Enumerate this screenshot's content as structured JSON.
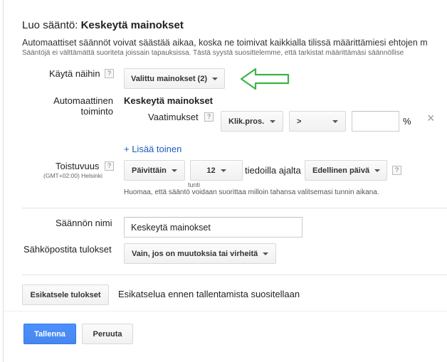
{
  "dialog": {
    "title_prefix": "Luo sääntö:",
    "title_rule": "Keskeytä mainokset",
    "description": "Automaattiset säännöt voivat säästää aikaa, koska ne toimivat kaikkialla tilissä määrittämiesi ehtojen m",
    "description_small": "Sääntöjä ei välttämättä suoriteta joissain tapauksissa. Tästä syystä suosittelemme, että tarkistat määrittämäsi säännöllise"
  },
  "apply_to": {
    "label": "Käytä näihin",
    "help": "?",
    "button": "Valittu mainokset (2)"
  },
  "action": {
    "label_line1": "Automaattinen",
    "label_line2": "toiminto",
    "value": "Keskeytä mainokset"
  },
  "requirements": {
    "label": "Vaatimukset",
    "help": "?",
    "metric": "Klik.pros.",
    "operator": ">",
    "value": "",
    "unit": "%",
    "remove": "×",
    "add_another": "+ Lisää toinen"
  },
  "frequency": {
    "label": "Toistuvuus",
    "help": "?",
    "timezone": "(GMT+02:00) Helsinki",
    "period": "Päivittäin",
    "hour": "12",
    "hour_unit": "tunti",
    "data_from": "tiedoilla ajalta",
    "range": "Edellinen päivä",
    "help2": "?",
    "note": "Huomaa, että sääntö voidaan suorittaa milloin tahansa valitsemasi tunnin aikana."
  },
  "rule_name": {
    "label": "Säännön nimi",
    "value": "Keskeytä mainokset"
  },
  "email": {
    "label": "Sähköpostita tulokset",
    "button": "Vain, jos on muutoksia tai virheitä"
  },
  "preview": {
    "button": "Esikatsele tulokset",
    "text": "Esikatselua ennen tallentamista suositellaan"
  },
  "footer": {
    "save": "Tallenna",
    "cancel": "Peruuta"
  },
  "colors": {
    "accent": "#4d90fe",
    "link": "#1a5bbf",
    "annotation_arrow": "#3db34a"
  },
  "icons": {
    "annotation": "arrow-left-outline-icon"
  }
}
